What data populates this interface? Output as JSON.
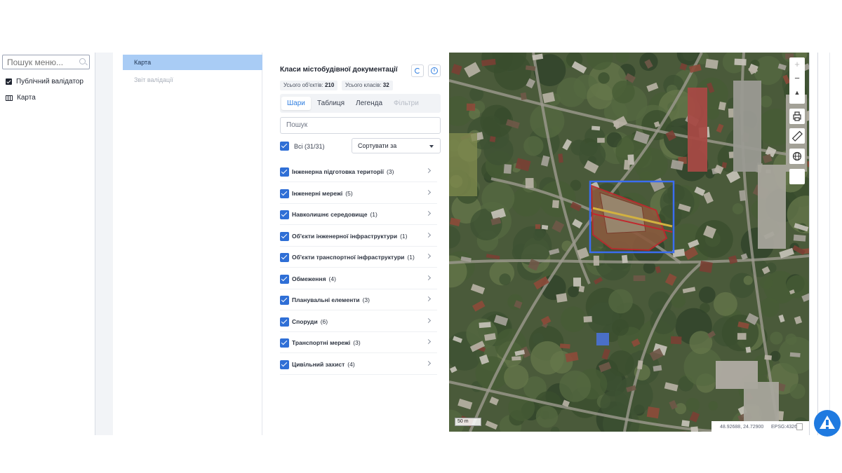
{
  "menu": {
    "search_placeholder": "Пошук меню...",
    "items": [
      {
        "label": "Публічний валідатор",
        "icon": "checkbox-icon"
      },
      {
        "label": "Карта",
        "icon": "map-icon"
      }
    ]
  },
  "subnav": {
    "active_item": "Карта",
    "items": [
      "Звіт валідації"
    ]
  },
  "panel": {
    "title": "Класи містобудівної документації",
    "stats": {
      "objects_label": "Усього об'єктів:",
      "objects_value": "210",
      "classes_label": "Усього класів:",
      "classes_value": "32"
    },
    "tabs": [
      {
        "label": "Шари",
        "state": "active"
      },
      {
        "label": "Таблиця",
        "state": "normal"
      },
      {
        "label": "Легенда",
        "state": "normal"
      },
      {
        "label": "Фільтри",
        "state": "disabled"
      }
    ],
    "search_placeholder": "Пошук",
    "all_label": "Всі (31/31)",
    "sort_label": "Сортувати за",
    "layers": [
      {
        "name": "Інженерна підготовка території",
        "count": "(3)"
      },
      {
        "name": "Інженерні мережі",
        "count": "(5)"
      },
      {
        "name": "Навколишнє середовище",
        "count": "(1)"
      },
      {
        "name": "Об'єкти інженерної інфраструктури",
        "count": "(1)"
      },
      {
        "name": "Об'єкти транспортної інфраструктури",
        "count": "(1)"
      },
      {
        "name": "Обмеження",
        "count": "(4)"
      },
      {
        "name": "Планувальні елементи",
        "count": "(3)"
      },
      {
        "name": "Споруди",
        "count": "(6)"
      },
      {
        "name": "Транспортні мережі",
        "count": "(3)"
      },
      {
        "name": "Цивільний захист",
        "count": "(4)"
      }
    ]
  },
  "map": {
    "controls": {
      "zoom_in": "+",
      "zoom_out": "−",
      "north": "▲"
    },
    "scale_label": "50 m",
    "coordinates": "48.92688, 24.72900",
    "projection": "EPSG:4326",
    "selection_color": "#3b6df0",
    "feature_color": "#c0282e"
  },
  "colors": {
    "accent": "#2f7ee0",
    "checkbox": "#2f6fd6",
    "active_subnav": "#a9ccf5"
  }
}
